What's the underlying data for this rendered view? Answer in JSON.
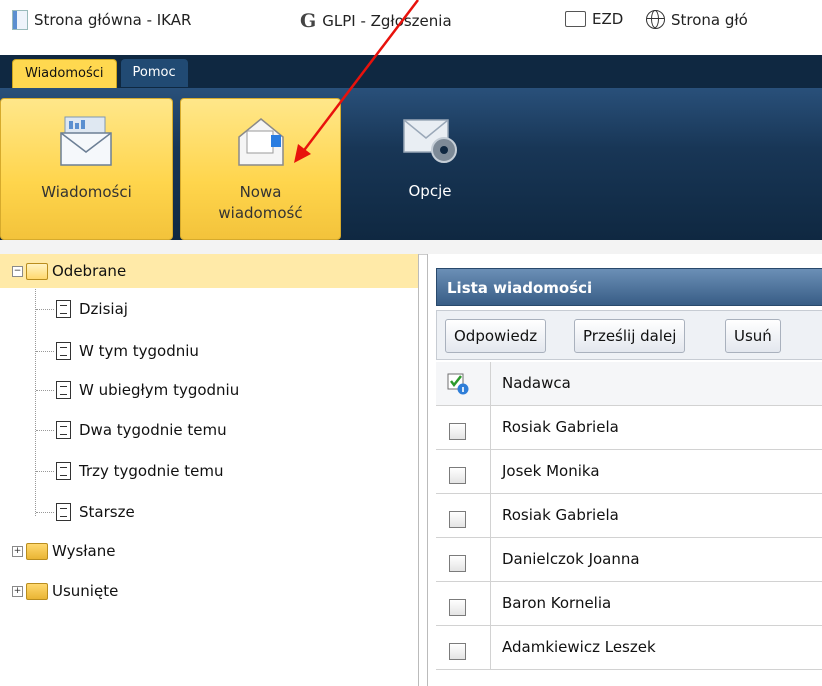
{
  "bookmarks": [
    {
      "label": "Strona główna - IKAR",
      "icon": "page-icon"
    },
    {
      "label": "GLPI - Zgłoszenia",
      "icon": "glpi-icon"
    },
    {
      "label": "EZD",
      "icon": "folder-icon"
    },
    {
      "label": "Strona głó",
      "icon": "globe-icon"
    }
  ],
  "tabs": {
    "messages": "Wiadomości",
    "help": "Pomoc"
  },
  "toolbar": {
    "messages_label": "Wiadomości",
    "new_line1": "Nowa",
    "new_line2": "wiadomość",
    "options_label": "Opcje"
  },
  "tree": {
    "inbox": "Odebrane",
    "today": "Dzisiaj",
    "this_week": "W tym tygodniu",
    "last_week": "W ubiegłym tygodniu",
    "two_weeks": "Dwa tygodnie temu",
    "three_weeks": "Trzy tygodnie temu",
    "older": "Starsze",
    "sent": "Wysłane",
    "deleted": "Usunięte"
  },
  "list": {
    "title": "Lista wiadomości",
    "reply": "Odpowiedz",
    "forward": "Prześlij dalej",
    "delete": "Usuń",
    "col_sender": "Nadawca",
    "rows": [
      "Rosiak Gabriela",
      "Josek Monika",
      "Rosiak Gabriela",
      "Danielczok Joanna",
      "Baron Kornelia",
      "Adamkiewicz Leszek"
    ]
  },
  "colors": {
    "ribbon": "#0f2841",
    "highlight": "#ffd54c",
    "selected": "#ffeaa8",
    "arrow": "#e8120c"
  }
}
